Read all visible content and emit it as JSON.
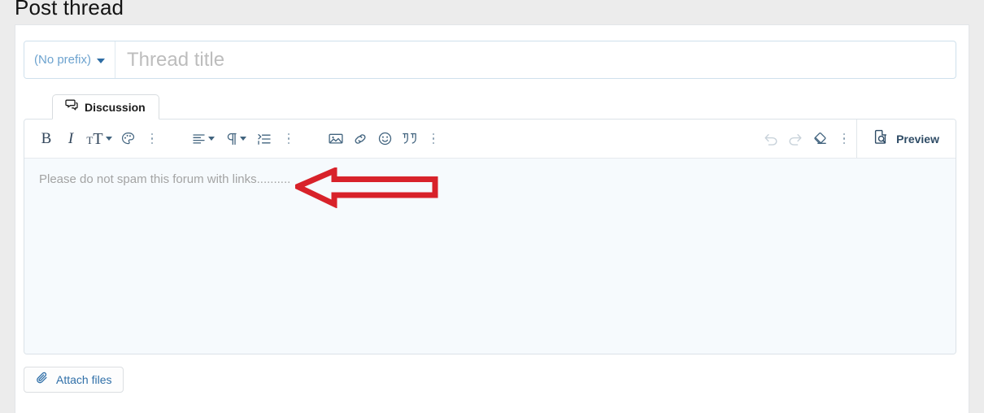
{
  "page": {
    "title": "Post thread",
    "background_color": "#ececec"
  },
  "thread_form": {
    "prefix": {
      "label": "(No prefix)",
      "icon": "chevron-down-icon"
    },
    "title_field": {
      "value": "",
      "placeholder": "Thread title"
    },
    "tabs": [
      {
        "label": "Discussion",
        "icon": "discussion-bubbles-icon",
        "active": true
      }
    ],
    "editor": {
      "toolbar": {
        "groups": [
          {
            "name": "text-format",
            "buttons": [
              {
                "name": "bold-button",
                "label": "B",
                "icon": "bold-icon",
                "disabled": false
              },
              {
                "name": "italic-button",
                "label": "I",
                "icon": "italic-icon",
                "disabled": false
              },
              {
                "name": "font-size-button",
                "label": "TT",
                "icon": "font-size-icon",
                "disabled": false
              },
              {
                "name": "text-color-button",
                "label": "",
                "icon": "palette-icon",
                "disabled": false
              },
              {
                "name": "text-more-button",
                "label": "",
                "icon": "kebab-menu-icon",
                "disabled": false
              }
            ]
          },
          {
            "name": "paragraph-format",
            "buttons": [
              {
                "name": "align-button",
                "label": "",
                "icon": "align-left-icon",
                "disabled": false
              },
              {
                "name": "paragraph-button",
                "label": "",
                "icon": "pilcrow-icon",
                "disabled": false
              },
              {
                "name": "list-indent-button",
                "label": "",
                "icon": "indent-list-icon",
                "disabled": false
              },
              {
                "name": "paragraph-more-button",
                "label": "",
                "icon": "kebab-menu-icon",
                "disabled": false
              }
            ]
          },
          {
            "name": "insert",
            "buttons": [
              {
                "name": "insert-image-button",
                "label": "",
                "icon": "image-icon",
                "disabled": false
              },
              {
                "name": "insert-link-button",
                "label": "",
                "icon": "link-icon",
                "disabled": false
              },
              {
                "name": "insert-emoji-button",
                "label": "",
                "icon": "smiley-icon",
                "disabled": false
              },
              {
                "name": "insert-quote-button",
                "label": "",
                "icon": "quote-icon",
                "disabled": false
              },
              {
                "name": "insert-more-button",
                "label": "",
                "icon": "kebab-menu-icon",
                "disabled": false
              }
            ]
          },
          {
            "name": "history",
            "buttons": [
              {
                "name": "undo-button",
                "label": "",
                "icon": "undo-icon",
                "disabled": true
              },
              {
                "name": "redo-button",
                "label": "",
                "icon": "redo-icon",
                "disabled": true
              },
              {
                "name": "remove-formatting-button",
                "label": "",
                "icon": "eraser-icon",
                "disabled": false
              },
              {
                "name": "history-more-button",
                "label": "",
                "icon": "kebab-menu-icon",
                "disabled": false
              }
            ]
          }
        ],
        "preview": {
          "label": "Preview",
          "icon": "document-search-icon"
        }
      },
      "content": {
        "text": "Please do not spam this forum with links..........",
        "is_placeholder_style": true
      }
    },
    "attach": {
      "label": "Attach files",
      "icon": "paperclip-icon"
    }
  },
  "annotation": {
    "type": "arrow",
    "direction": "left",
    "color": "#d8222a",
    "points_at": "editor-content-text"
  },
  "colors": {
    "accent_blue": "#2f6fa8",
    "prefix_blue": "#6da3cf",
    "toolbar_icon": "#41637e",
    "annotation_red": "#d8222a",
    "placeholder_gray": "#a3a3a3"
  }
}
